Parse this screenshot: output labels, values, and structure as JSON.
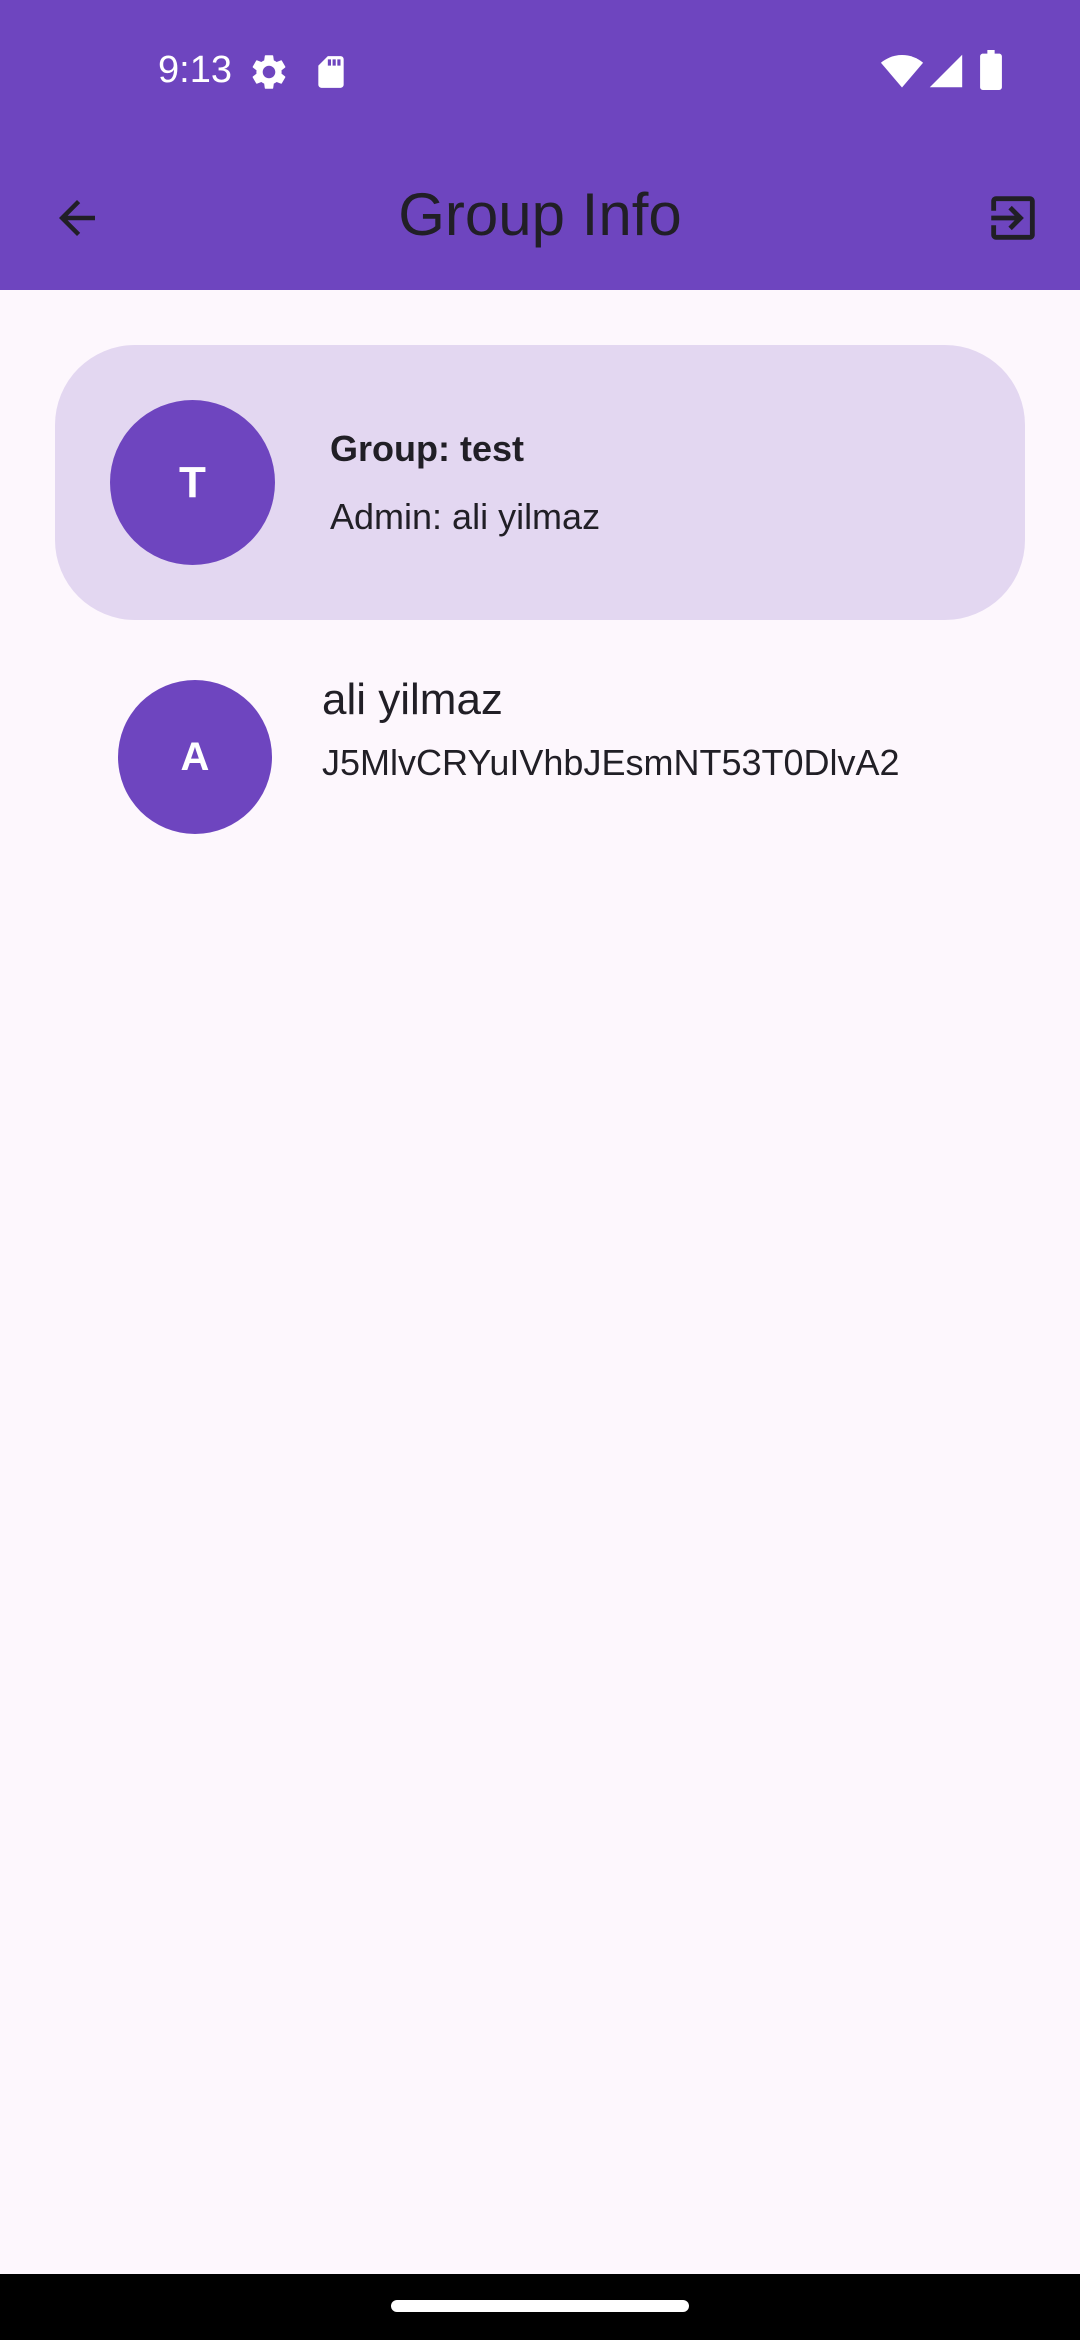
{
  "status_bar": {
    "time": "9:13",
    "icons": [
      "settings-gear-icon",
      "sd-card-icon",
      "wifi-icon",
      "cellular-signal-icon",
      "battery-icon"
    ]
  },
  "app_bar": {
    "title": "Group Info",
    "back_icon": "arrow-back-icon",
    "action_icon": "exit-to-app-icon"
  },
  "group": {
    "avatar_initial": "T",
    "name_line": "Group: test",
    "admin_line": "Admin: ali yilmaz"
  },
  "members": [
    {
      "avatar_initial": "A",
      "name": "ali yilmaz",
      "id": "J5MlvCRYuIVhbJEsmNT53T0DlvA2"
    }
  ],
  "colors": {
    "primary": "#6e45bf",
    "card_background": "#e3d7f1",
    "surface": "#fdf7fd",
    "on_surface": "#211f26"
  }
}
